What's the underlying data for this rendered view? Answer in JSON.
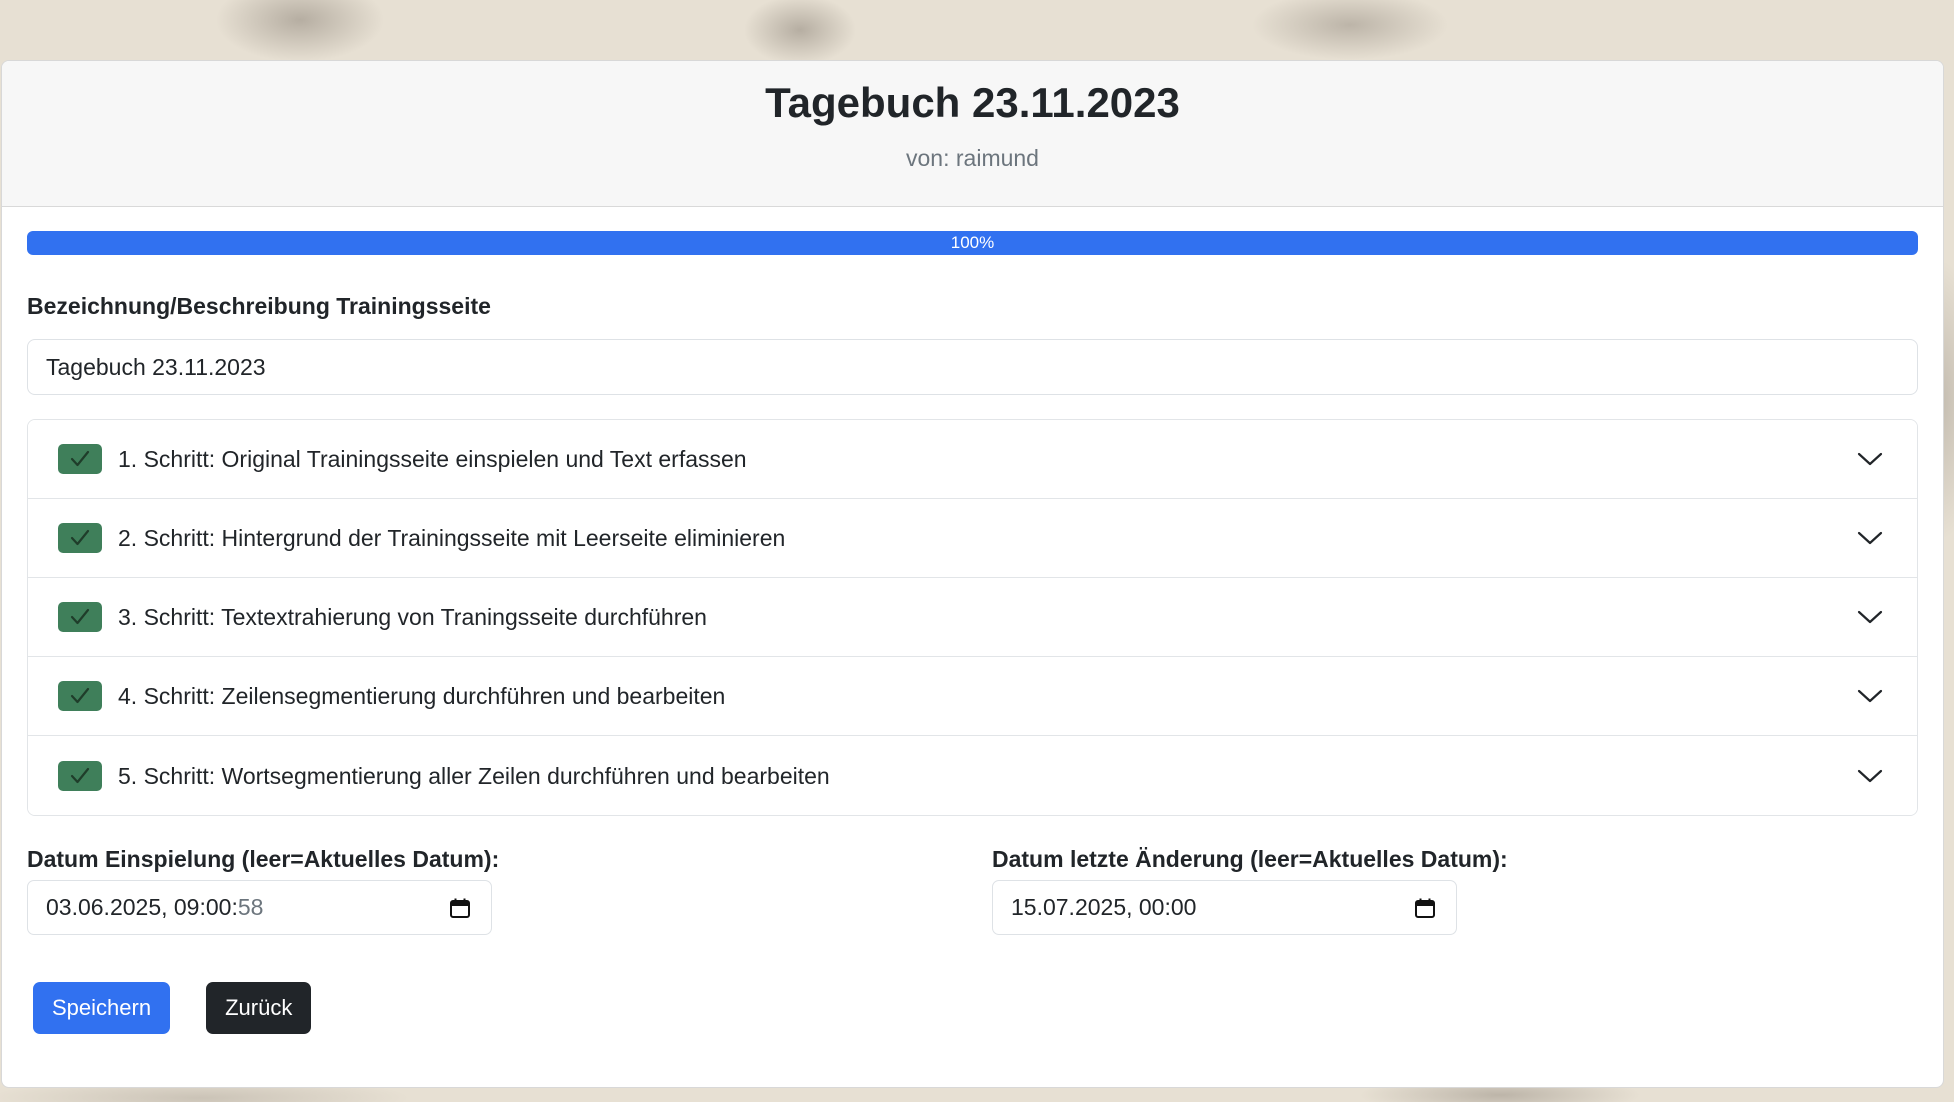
{
  "header": {
    "title": "Tagebuch 23.11.2023",
    "subtitle": "von: raimund"
  },
  "progress": {
    "label": "100%",
    "value": 100
  },
  "description_field": {
    "label": "Bezeichnung/Beschreibung Trainingsseite",
    "value": "Tagebuch 23.11.2023"
  },
  "steps": [
    {
      "label": "1. Schritt: Original Trainingsseite einspielen und Text erfassen",
      "done": true
    },
    {
      "label": "2. Schritt: Hintergrund der Trainingsseite mit Leerseite eliminieren",
      "done": true
    },
    {
      "label": "3. Schritt: Textextrahierung von Traningsseite durchführen",
      "done": true
    },
    {
      "label": "4. Schritt: Zeilensegmentierung durchführen und bearbeiten",
      "done": true
    },
    {
      "label": "5. Schritt: Wortsegmentierung aller Zeilen durchführen und bearbeiten",
      "done": true
    }
  ],
  "dates": {
    "import": {
      "label": "Datum Einspielung (leer=Aktuelles Datum):",
      "value_main": "03.06.2025, 09:00:",
      "value_muted": "58"
    },
    "modified": {
      "label": "Datum letzte Änderung (leer=Aktuelles Datum):",
      "value_main": "15.07.2025, 00:00",
      "value_muted": ""
    }
  },
  "buttons": {
    "save": "Speichern",
    "back": "Zurück"
  },
  "colors": {
    "primary": "#3171f0",
    "success_check": "#3f7f5a",
    "dark_button": "#212529"
  }
}
